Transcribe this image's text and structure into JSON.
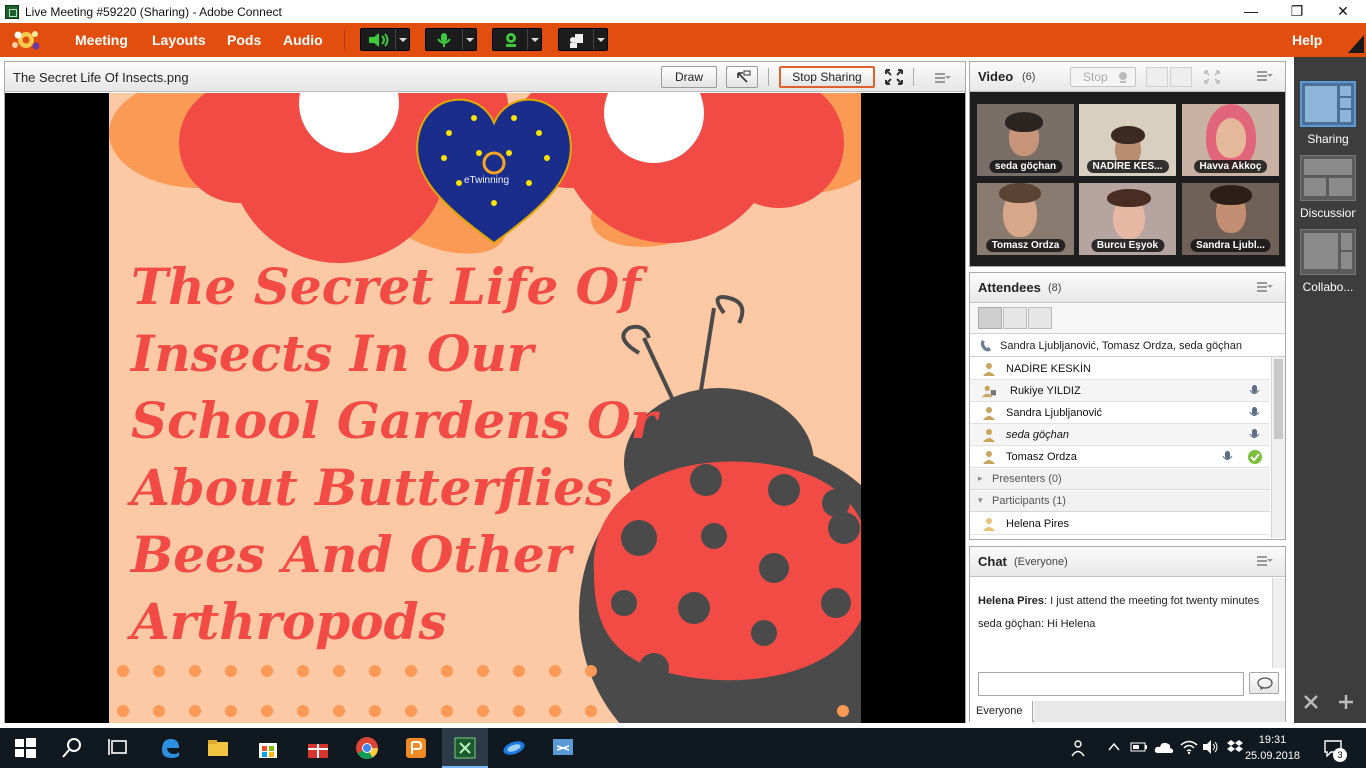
{
  "window": {
    "title": "Live Meeting #59220 (Sharing) - Adobe Connect",
    "minimize": "—",
    "maximize": "❐",
    "close": "✕"
  },
  "menubar": {
    "items": [
      "Meeting",
      "Layouts",
      "Pods",
      "Audio"
    ],
    "help": "Help",
    "brand_color": "#e24e0e"
  },
  "share": {
    "title": "The Secret Life Of Insects.png",
    "draw_label": "Draw",
    "stop_sharing_label": "Stop Sharing",
    "slide": {
      "heading_lines": [
        "The Secret Life Of",
        "Insects In Our",
        "School Gardens Or",
        "About Butterflies",
        "Bees And Other",
        "Arthropods"
      ],
      "logo_text": "eTwinning"
    }
  },
  "video": {
    "title": "Video",
    "count": "(6)",
    "stop_label": "Stop",
    "tiles": [
      "seda göçhan",
      "NADİRE KES...",
      "Havva Akkoç",
      "Tomasz Ordza",
      "Burcu Eşyok",
      "Sandra Ljubl..."
    ]
  },
  "attendees": {
    "title": "Attendees",
    "count": "(8)",
    "speaking": "Sandra Ljubljanović, Tomasz Ordza, seda göçhan",
    "hosts": [
      {
        "name": "NADİRE KESKİN",
        "mic": false,
        "italic": false
      },
      {
        "name": "Rukiye YILDIZ",
        "mic": true,
        "italic": false
      },
      {
        "name": "Sandra Ljubljanović",
        "mic": true,
        "italic": false
      },
      {
        "name": "seda göçhan",
        "mic": true,
        "italic": true
      },
      {
        "name": "Tomasz Ordza",
        "mic": true,
        "italic": false,
        "status": "check"
      }
    ],
    "presenters_label": "Presenters (0)",
    "participants_label": "Participants (1)",
    "participants": [
      "Helena Pires"
    ]
  },
  "chat": {
    "title": "Chat",
    "scope": "(Everyone)",
    "messages": [
      {
        "sender": "Helena Pires",
        "text": "I just attend the meeting fot twenty minutes"
      },
      {
        "sender": "seda göçhan",
        "text": "Hi Helena"
      }
    ],
    "input_value": "",
    "tab_label": "Everyone"
  },
  "sidebar": {
    "layouts": [
      "Sharing",
      "Discussion",
      "Collabo..."
    ]
  },
  "taskbar": {
    "time": "19:31",
    "date": "25.09.2018",
    "notification_count": "3"
  }
}
